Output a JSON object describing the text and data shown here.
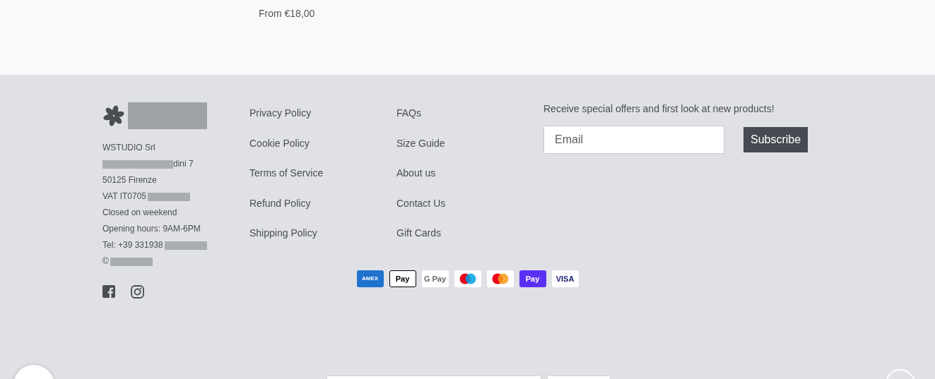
{
  "product": {
    "price": "From €18,00"
  },
  "company": {
    "lines": [
      {
        "kind": "plain",
        "text": "WSTUDIO Srl"
      },
      {
        "kind": "blurstart",
        "text": "dini 7"
      },
      {
        "kind": "plain",
        "text": "50125 Firenze"
      },
      {
        "kind": "blurend",
        "text": "VAT IT0705"
      },
      {
        "kind": "plain",
        "text": "Closed on weekend"
      },
      {
        "kind": "plain",
        "text": "Opening hours: 9AM-6PM"
      },
      {
        "kind": "blurend",
        "text": "Tel: +39 331938"
      },
      {
        "kind": "blurend",
        "text": "©"
      }
    ]
  },
  "policy_links": [
    "Privacy Policy",
    "Cookie Policy",
    "Terms of Service",
    "Refund Policy",
    "Shipping Policy"
  ],
  "help_links": [
    "FAQs",
    "Size Guide",
    "About us",
    "Contact Us",
    "Gift Cards"
  ],
  "newsletter": {
    "heading": "Receive special offers and first look at new products!",
    "placeholder": "Email",
    "button": "Subscribe"
  },
  "payment_methods": [
    {
      "kind": "amex",
      "label": "AMEX"
    },
    {
      "kind": "applepay",
      "label": "Pay"
    },
    {
      "kind": "gpay",
      "label": "G Pay"
    },
    {
      "kind": "maestro"
    },
    {
      "kind": "mastercard"
    },
    {
      "kind": "shoppay",
      "label": "Pay"
    },
    {
      "kind": "visa",
      "label": "VISA"
    }
  ]
}
